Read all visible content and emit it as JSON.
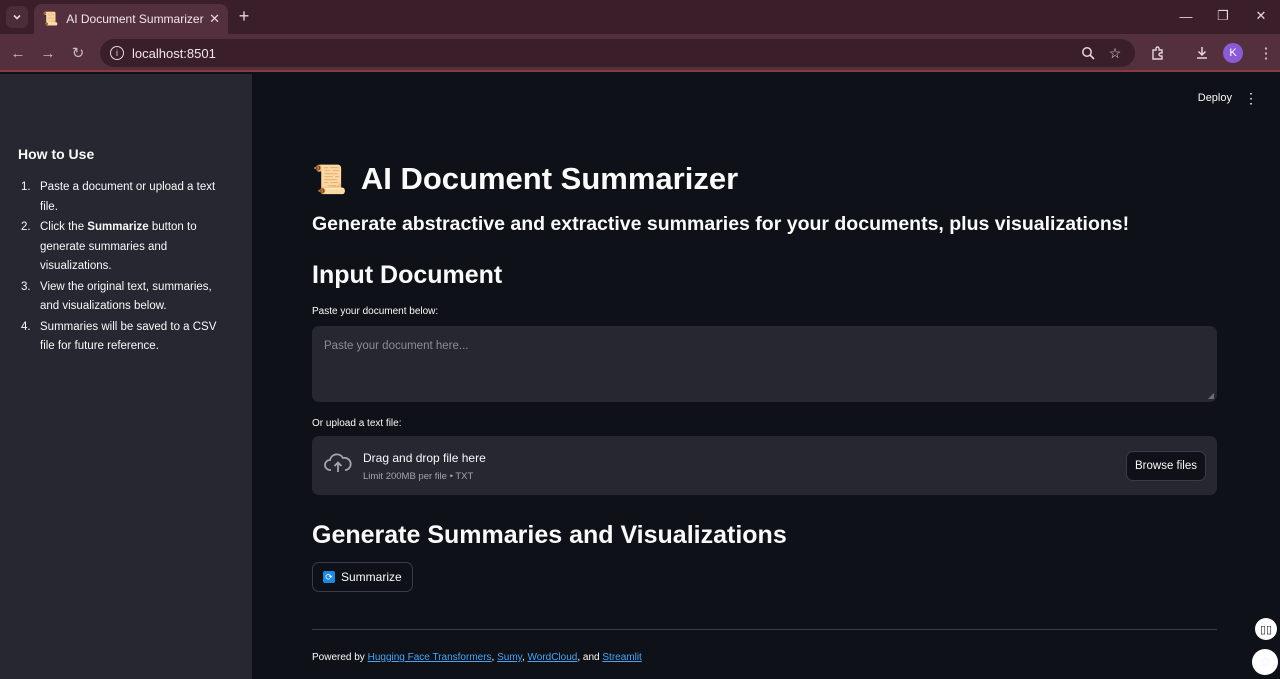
{
  "browser": {
    "tab_title": "AI Document Summarizer",
    "tab_icon": "📜",
    "url": "localhost:8501",
    "avatar_letter": "K"
  },
  "app": {
    "deploy_label": "Deploy"
  },
  "sidebar": {
    "heading": "How to Use",
    "steps": [
      {
        "num": "1.",
        "text": "Paste a document or upload a text file."
      },
      {
        "num": "2.",
        "pre": "Click the ",
        "bold": "Summarize",
        "post": " button to generate summaries and visualizations."
      },
      {
        "num": "3.",
        "text": "View the original text, summaries, and visualizations below."
      },
      {
        "num": "4.",
        "text": "Summaries will be saved to a CSV file for future reference."
      }
    ]
  },
  "main": {
    "title_icon": "📜",
    "title": "AI Document Summarizer",
    "subtitle": "Generate abstractive and extractive summaries for your documents, plus visualizations!",
    "input_heading": "Input Document",
    "paste_label": "Paste your document below:",
    "paste_placeholder": "Paste your document here...",
    "upload_label": "Or upload a text file:",
    "dropzone_title": "Drag and drop file here",
    "dropzone_limit": "Limit 200MB per file • TXT",
    "browse_label": "Browse files",
    "generate_heading": "Generate Summaries and Visualizations",
    "summarize_label": "Summarize",
    "footer": {
      "prefix": "Powered by ",
      "link1": "Hugging Face Transformers",
      "sep1": ", ",
      "link2": "Sumy",
      "sep2": ", ",
      "link3": "WordCloud",
      "sep3": ", and ",
      "link4": "Streamlit"
    }
  }
}
